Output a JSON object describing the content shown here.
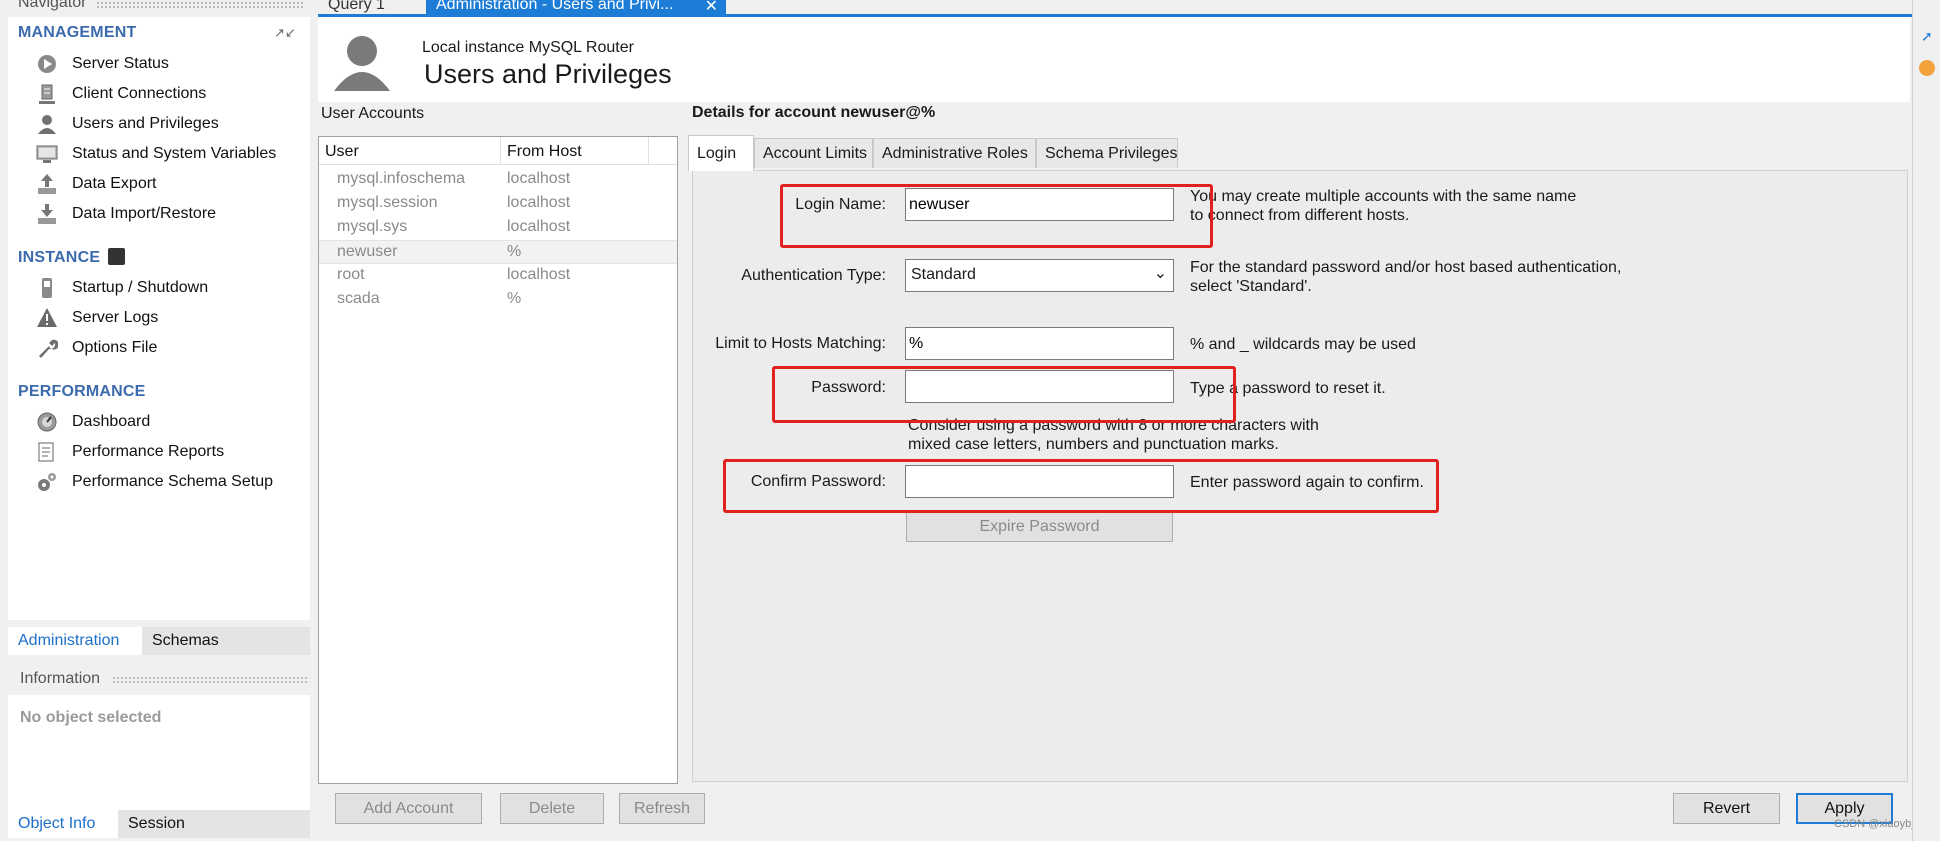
{
  "navigator": {
    "title": "Navigator",
    "management": {
      "heading": "MANAGEMENT",
      "items": [
        {
          "label": "Server Status",
          "icon": "play-circle-icon"
        },
        {
          "label": "Client Connections",
          "icon": "server-rack-icon"
        },
        {
          "label": "Users and Privileges",
          "icon": "user-icon"
        },
        {
          "label": "Status and System Variables",
          "icon": "monitor-icon"
        },
        {
          "label": "Data Export",
          "icon": "export-icon"
        },
        {
          "label": "Data Import/Restore",
          "icon": "import-icon"
        }
      ]
    },
    "instance": {
      "heading": "INSTANCE",
      "items": [
        {
          "label": "Startup / Shutdown",
          "icon": "power-switch-icon"
        },
        {
          "label": "Server Logs",
          "icon": "warning-icon"
        },
        {
          "label": "Options File",
          "icon": "wrench-icon"
        }
      ]
    },
    "performance": {
      "heading": "PERFORMANCE",
      "items": [
        {
          "label": "Dashboard",
          "icon": "gauge-icon"
        },
        {
          "label": "Performance Reports",
          "icon": "report-icon"
        },
        {
          "label": "Performance Schema Setup",
          "icon": "gears-icon"
        }
      ]
    },
    "bottom_tabs": [
      "Administration",
      "Schemas"
    ],
    "information": {
      "title": "Information",
      "empty_text": "No object selected",
      "tabs": [
        "Object Info",
        "Session"
      ]
    }
  },
  "editor_tabs": [
    {
      "label": "Query 1"
    },
    {
      "label": "Administration - Users and Privi..."
    }
  ],
  "banner": {
    "subtitle": "Local instance MySQL Router",
    "title": "Users and Privileges"
  },
  "user_accounts": {
    "heading": "User Accounts",
    "columns": [
      "User",
      "From Host"
    ],
    "rows": [
      [
        "mysql.infoschema",
        "localhost"
      ],
      [
        "mysql.session",
        "localhost"
      ],
      [
        "mysql.sys",
        "localhost"
      ],
      [
        "newuser",
        "%"
      ],
      [
        "root",
        "localhost"
      ],
      [
        "scada",
        "%"
      ]
    ],
    "selected_index": 3
  },
  "details": {
    "heading": "Details for account newuser@%",
    "tabs": [
      "Login",
      "Account Limits",
      "Administrative Roles",
      "Schema Privileges"
    ],
    "active_tab": "Login",
    "login_name_label": "Login Name:",
    "login_name_value": "newuser",
    "login_name_note1": "You may create multiple accounts with the same name",
    "login_name_note2": "to connect from different hosts.",
    "auth_type_label": "Authentication Type:",
    "auth_type_value": "Standard",
    "auth_type_note1": "For the standard password and/or host based authentication,",
    "auth_type_note2": "select 'Standard'.",
    "hosts_label": "Limit to Hosts Matching:",
    "hosts_value": "%",
    "hosts_note": "% and _ wildcards may be used",
    "password_label": "Password:",
    "password_value": "",
    "password_note": "Type a password to reset it.",
    "password_hint1": "Consider using a password with 8 or more characters with",
    "password_hint2": "mixed case letters, numbers and punctuation marks.",
    "confirm_label": "Confirm Password:",
    "confirm_value": "",
    "confirm_note": "Enter password again to confirm.",
    "expire_button": "Expire Password"
  },
  "actions": {
    "add": "Add Account",
    "delete": "Delete",
    "refresh": "Refresh",
    "revert": "Revert",
    "apply": "Apply"
  },
  "watermark": "CSDN @xiaoyb_",
  "colors": {
    "accent": "#1c7cd6",
    "section_heading": "#3c6bad",
    "highlight_box": "#e12020"
  }
}
